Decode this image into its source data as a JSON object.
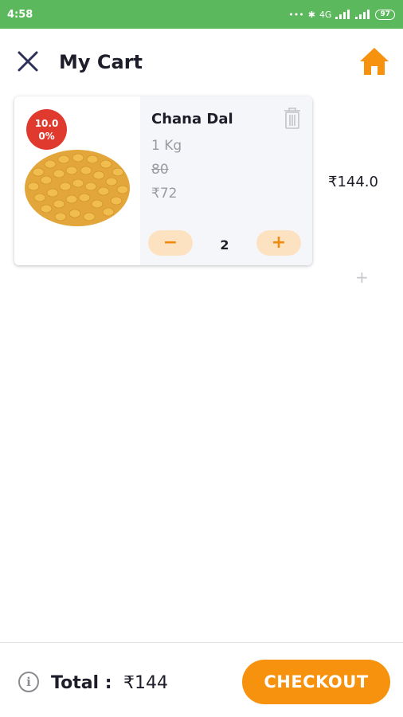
{
  "status_bar": {
    "time": "4:58",
    "network": "4G",
    "battery": "97"
  },
  "header": {
    "title": "My Cart",
    "close_icon": "close-icon",
    "home_icon": "home-icon"
  },
  "cart": {
    "items": [
      {
        "name": "Chana Dal",
        "discount_line1": "10.0",
        "discount_line2": "0%",
        "unit": "1 Kg",
        "mrp": "80",
        "price": "₹72",
        "quantity": "2",
        "minus_label": "−",
        "plus_label": "+",
        "line_total": "₹144.0"
      }
    ],
    "add_more_label": "+"
  },
  "footer": {
    "info_icon_label": "i",
    "total_label": "Total :",
    "total_value": "₹144",
    "checkout_label": "CHECKOUT"
  },
  "colors": {
    "status_bar": "#5cb85c",
    "accent": "#f7920f",
    "badge": "#e03a2f",
    "stepper_bg": "#fde2c2"
  }
}
